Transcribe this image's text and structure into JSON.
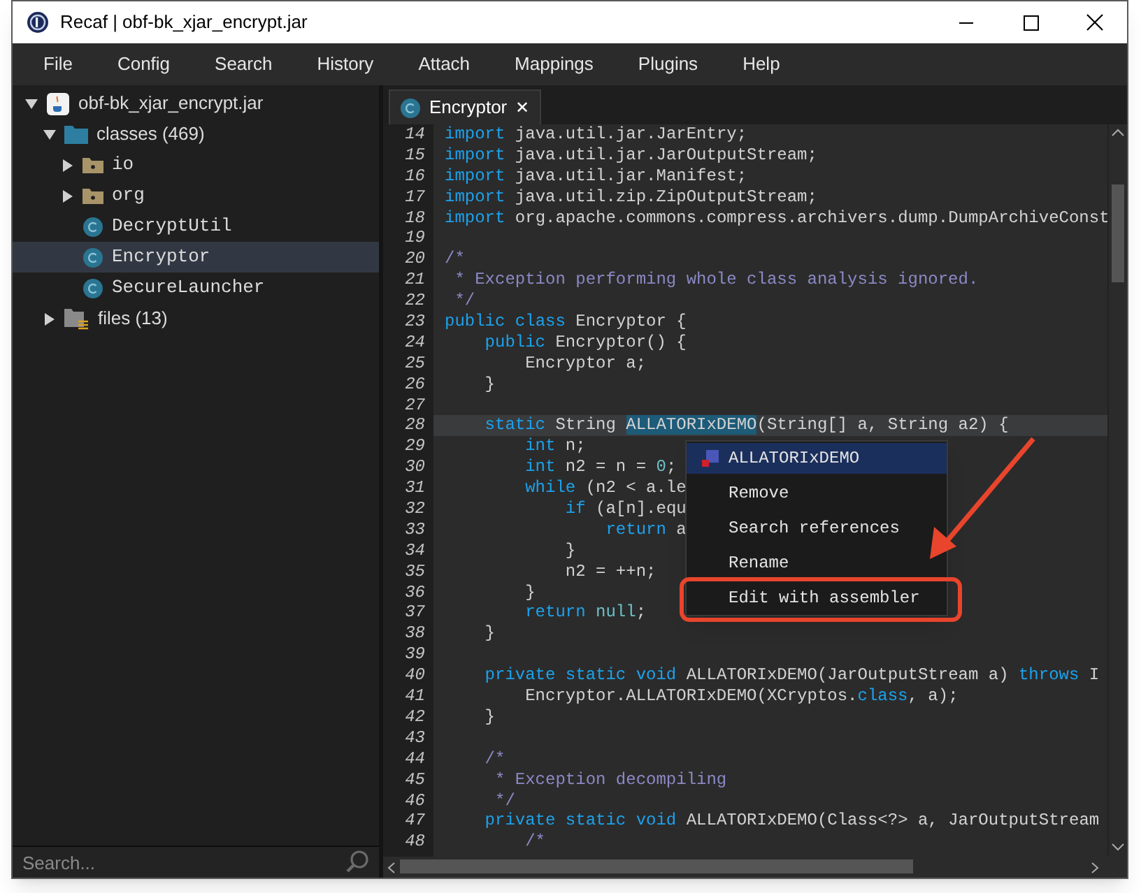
{
  "window": {
    "title": "Recaf | obf-bk_xjar_encrypt.jar"
  },
  "menu_bar": [
    "File",
    "Config",
    "Search",
    "History",
    "Attach",
    "Mappings",
    "Plugins",
    "Help"
  ],
  "tree": [
    {
      "label": "obf-bk_xjar_encrypt.jar",
      "kind": "jar",
      "expanded": true,
      "selected": false,
      "children": [
        {
          "label": "classes (469)",
          "kind": "folder",
          "expanded": true,
          "selected": false,
          "children": [
            {
              "label": "io",
              "kind": "package",
              "expanded": false,
              "selected": false
            },
            {
              "label": "org",
              "kind": "package",
              "expanded": false,
              "selected": false
            },
            {
              "label": "DecryptUtil",
              "kind": "class",
              "selected": false
            },
            {
              "label": "Encryptor",
              "kind": "class",
              "selected": true
            },
            {
              "label": "SecureLauncher",
              "kind": "class",
              "selected": false
            }
          ]
        },
        {
          "label": "files (13)",
          "kind": "files",
          "expanded": false,
          "selected": false
        }
      ]
    }
  ],
  "search": {
    "placeholder": "Search..."
  },
  "tabs": [
    {
      "label": "Encryptor",
      "selected": true,
      "close": "✕"
    }
  ],
  "code": {
    "lines": [
      {
        "number": "14",
        "current": false,
        "tokens": [
          {
            "kind": "keyword",
            "text": "import"
          },
          {
            "kind": "plain",
            "text": " java.util.jar.JarEntry;"
          }
        ]
      },
      {
        "number": "15",
        "current": false,
        "tokens": [
          {
            "kind": "keyword",
            "text": "import"
          },
          {
            "kind": "plain",
            "text": " java.util.jar.JarOutputStream;"
          }
        ]
      },
      {
        "number": "16",
        "current": false,
        "tokens": [
          {
            "kind": "keyword",
            "text": "import"
          },
          {
            "kind": "plain",
            "text": " java.util.jar.Manifest;"
          }
        ]
      },
      {
        "number": "17",
        "current": false,
        "tokens": [
          {
            "kind": "keyword",
            "text": "import"
          },
          {
            "kind": "plain",
            "text": " java.util.zip.ZipOutputStream;"
          }
        ]
      },
      {
        "number": "18",
        "current": false,
        "tokens": [
          {
            "kind": "keyword",
            "text": "import"
          },
          {
            "kind": "plain",
            "text": " org.apache.commons.compress.archivers.dump.DumpArchiveConst"
          }
        ]
      },
      {
        "number": "19",
        "current": false
      },
      {
        "number": "20",
        "current": false,
        "tokens": [
          {
            "kind": "comment",
            "text": "/*"
          }
        ]
      },
      {
        "number": "21",
        "current": false,
        "tokens": [
          {
            "kind": "comment",
            "text": " * Exception performing whole class analysis ignored."
          }
        ]
      },
      {
        "number": "22",
        "current": false,
        "tokens": [
          {
            "kind": "comment",
            "text": " */"
          }
        ]
      },
      {
        "number": "23",
        "current": false,
        "tokens": [
          {
            "kind": "keyword",
            "text": "public"
          },
          {
            "kind": "keyword",
            "text": " class"
          },
          {
            "kind": "plain",
            "text": " Encryptor {"
          }
        ]
      },
      {
        "number": "24",
        "current": false,
        "tokens": [
          {
            "kind": "keyword",
            "text": "    public"
          },
          {
            "kind": "plain",
            "text": " Encryptor() {"
          }
        ]
      },
      {
        "number": "25",
        "current": false,
        "tokens": [
          {
            "kind": "plain",
            "text": "        Encryptor a;"
          }
        ]
      },
      {
        "number": "26",
        "current": false,
        "tokens": [
          {
            "kind": "plain",
            "text": "    }"
          }
        ]
      },
      {
        "number": "27",
        "current": false
      },
      {
        "number": "28",
        "current": true,
        "tokens": [
          {
            "kind": "keyword",
            "text": "    static"
          },
          {
            "kind": "plain",
            "text": " String "
          },
          {
            "kind": "match",
            "text": "ALLATORIxDEMO"
          },
          {
            "kind": "plain",
            "text": "(String[] a, String a2) {"
          }
        ]
      },
      {
        "number": "29",
        "current": false,
        "tokens": [
          {
            "kind": "keyword",
            "text": "        int"
          },
          {
            "kind": "plain",
            "text": " n;"
          }
        ]
      },
      {
        "number": "30",
        "current": false,
        "tokens": [
          {
            "kind": "keyword",
            "text": "        int"
          },
          {
            "kind": "plain",
            "text": " n2 = n = "
          },
          {
            "kind": "literal",
            "text": "0"
          },
          {
            "kind": "plain",
            "text": ";"
          }
        ]
      },
      {
        "number": "31",
        "current": false,
        "tokens": [
          {
            "kind": "keyword",
            "text": "        while"
          },
          {
            "kind": "plain",
            "text": " (n2 < a.le"
          }
        ]
      },
      {
        "number": "32",
        "current": false,
        "tokens": [
          {
            "kind": "keyword",
            "text": "            if"
          },
          {
            "kind": "plain",
            "text": " (a[n].equ"
          }
        ]
      },
      {
        "number": "33",
        "current": false,
        "tokens": [
          {
            "kind": "keyword",
            "text": "                return"
          },
          {
            "kind": "plain",
            "text": " a"
          }
        ]
      },
      {
        "number": "34",
        "current": false,
        "tokens": [
          {
            "kind": "plain",
            "text": "            }"
          }
        ]
      },
      {
        "number": "35",
        "current": false,
        "tokens": [
          {
            "kind": "plain",
            "text": "            n2 = ++n;"
          }
        ]
      },
      {
        "number": "36",
        "current": false,
        "tokens": [
          {
            "kind": "plain",
            "text": "        }"
          }
        ]
      },
      {
        "number": "37",
        "current": false,
        "tokens": [
          {
            "kind": "keyword",
            "text": "        return"
          },
          {
            "kind": "literal",
            "text": " null"
          },
          {
            "kind": "plain",
            "text": ";"
          }
        ]
      },
      {
        "number": "38",
        "current": false,
        "tokens": [
          {
            "kind": "plain",
            "text": "    }"
          }
        ]
      },
      {
        "number": "39",
        "current": false
      },
      {
        "number": "40",
        "current": false,
        "tokens": [
          {
            "kind": "keyword",
            "text": "    private static void"
          },
          {
            "kind": "plain",
            "text": " ALLATORIxDEMO(JarOutputStream a) "
          },
          {
            "kind": "keyword",
            "text": "throws"
          },
          {
            "kind": "plain",
            "text": " I"
          }
        ]
      },
      {
        "number": "41",
        "current": false,
        "tokens": [
          {
            "kind": "plain",
            "text": "        Encryptor.ALLATORIxDEMO(XCryptos."
          },
          {
            "kind": "keyword",
            "text": "class"
          },
          {
            "kind": "plain",
            "text": ", a);"
          }
        ]
      },
      {
        "number": "42",
        "current": false,
        "tokens": [
          {
            "kind": "plain",
            "text": "    }"
          }
        ]
      },
      {
        "number": "43",
        "current": false
      },
      {
        "number": "44",
        "current": false,
        "tokens": [
          {
            "kind": "comment",
            "text": "    /*"
          }
        ]
      },
      {
        "number": "45",
        "current": false,
        "tokens": [
          {
            "kind": "comment",
            "text": "     * Exception decompiling"
          }
        ]
      },
      {
        "number": "46",
        "current": false,
        "tokens": [
          {
            "kind": "comment",
            "text": "     */"
          }
        ]
      },
      {
        "number": "47",
        "current": false,
        "tokens": [
          {
            "kind": "keyword",
            "text": "    private static void"
          },
          {
            "kind": "plain",
            "text": " ALLATORIxDEMO(Class<?> a, JarOutputStream"
          }
        ]
      },
      {
        "number": "48",
        "current": false,
        "tokens": [
          {
            "kind": "comment",
            "text": "        /*"
          }
        ]
      }
    ]
  },
  "context_menu": [
    {
      "label": "ALLATORIxDEMO",
      "kind": "header",
      "selected": true
    },
    {
      "label": "Remove",
      "kind": "action",
      "selected": false
    },
    {
      "label": "Search references",
      "kind": "action",
      "selected": false
    },
    {
      "label": "Rename",
      "kind": "action",
      "selected": false
    },
    {
      "label": "Edit with assembler",
      "kind": "action",
      "selected": false
    }
  ]
}
